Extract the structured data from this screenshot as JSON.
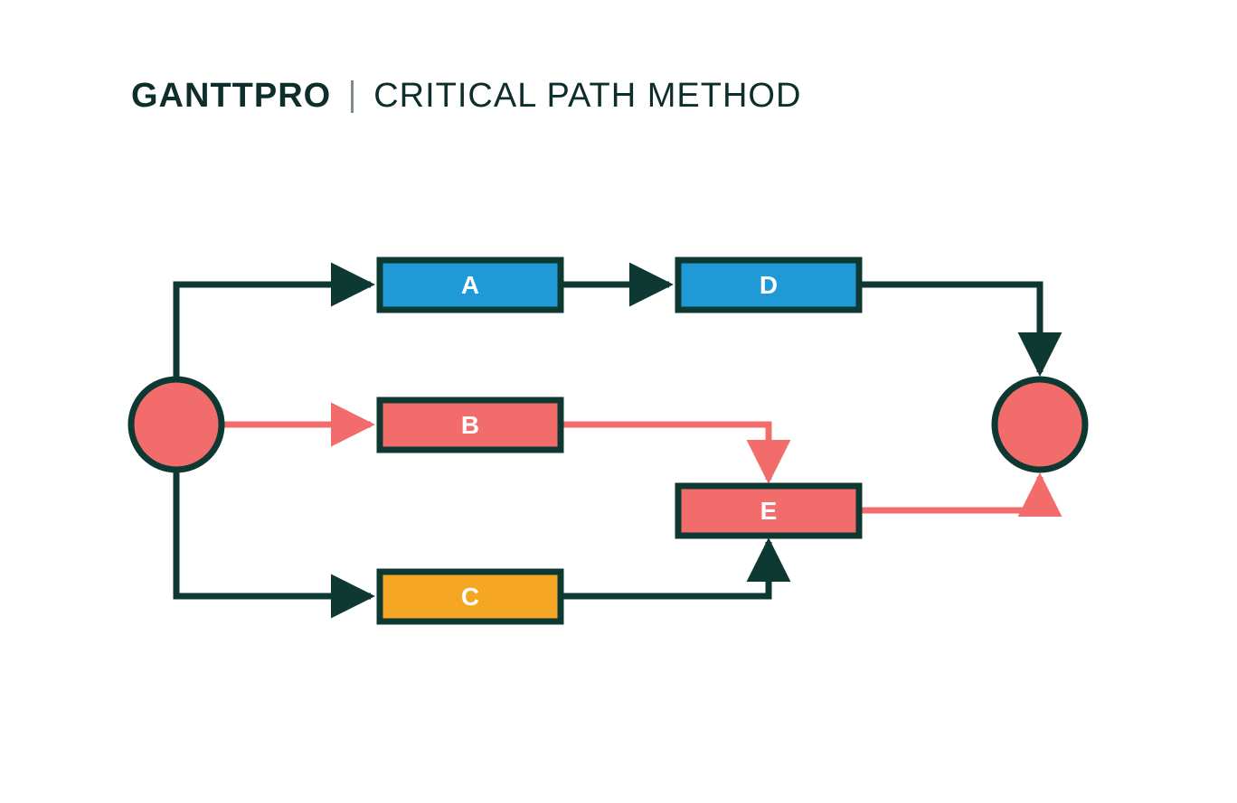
{
  "header": {
    "logo": "GANTTPRO",
    "title": "CRITICAL PATH METHOD"
  },
  "colors": {
    "dark": "#0e3832",
    "blue": "#1f9ad6",
    "red": "#f36c6c",
    "orange": "#f5a623",
    "white": "#ffffff"
  },
  "nodes": {
    "start": {
      "label": ""
    },
    "end": {
      "label": ""
    },
    "A": {
      "label": "A",
      "fill": "blue"
    },
    "B": {
      "label": "B",
      "fill": "red"
    },
    "C": {
      "label": "C",
      "fill": "orange"
    },
    "D": {
      "label": "D",
      "fill": "blue"
    },
    "E": {
      "label": "E",
      "fill": "red"
    }
  },
  "critical_path": [
    "start",
    "B",
    "E",
    "end"
  ],
  "edges": [
    {
      "from": "start",
      "to": "A",
      "critical": false
    },
    {
      "from": "start",
      "to": "B",
      "critical": true
    },
    {
      "from": "start",
      "to": "C",
      "critical": false
    },
    {
      "from": "A",
      "to": "D",
      "critical": false
    },
    {
      "from": "D",
      "to": "end",
      "critical": false
    },
    {
      "from": "B",
      "to": "E",
      "critical": true
    },
    {
      "from": "C",
      "to": "E",
      "critical": false
    },
    {
      "from": "E",
      "to": "end",
      "critical": true
    }
  ]
}
